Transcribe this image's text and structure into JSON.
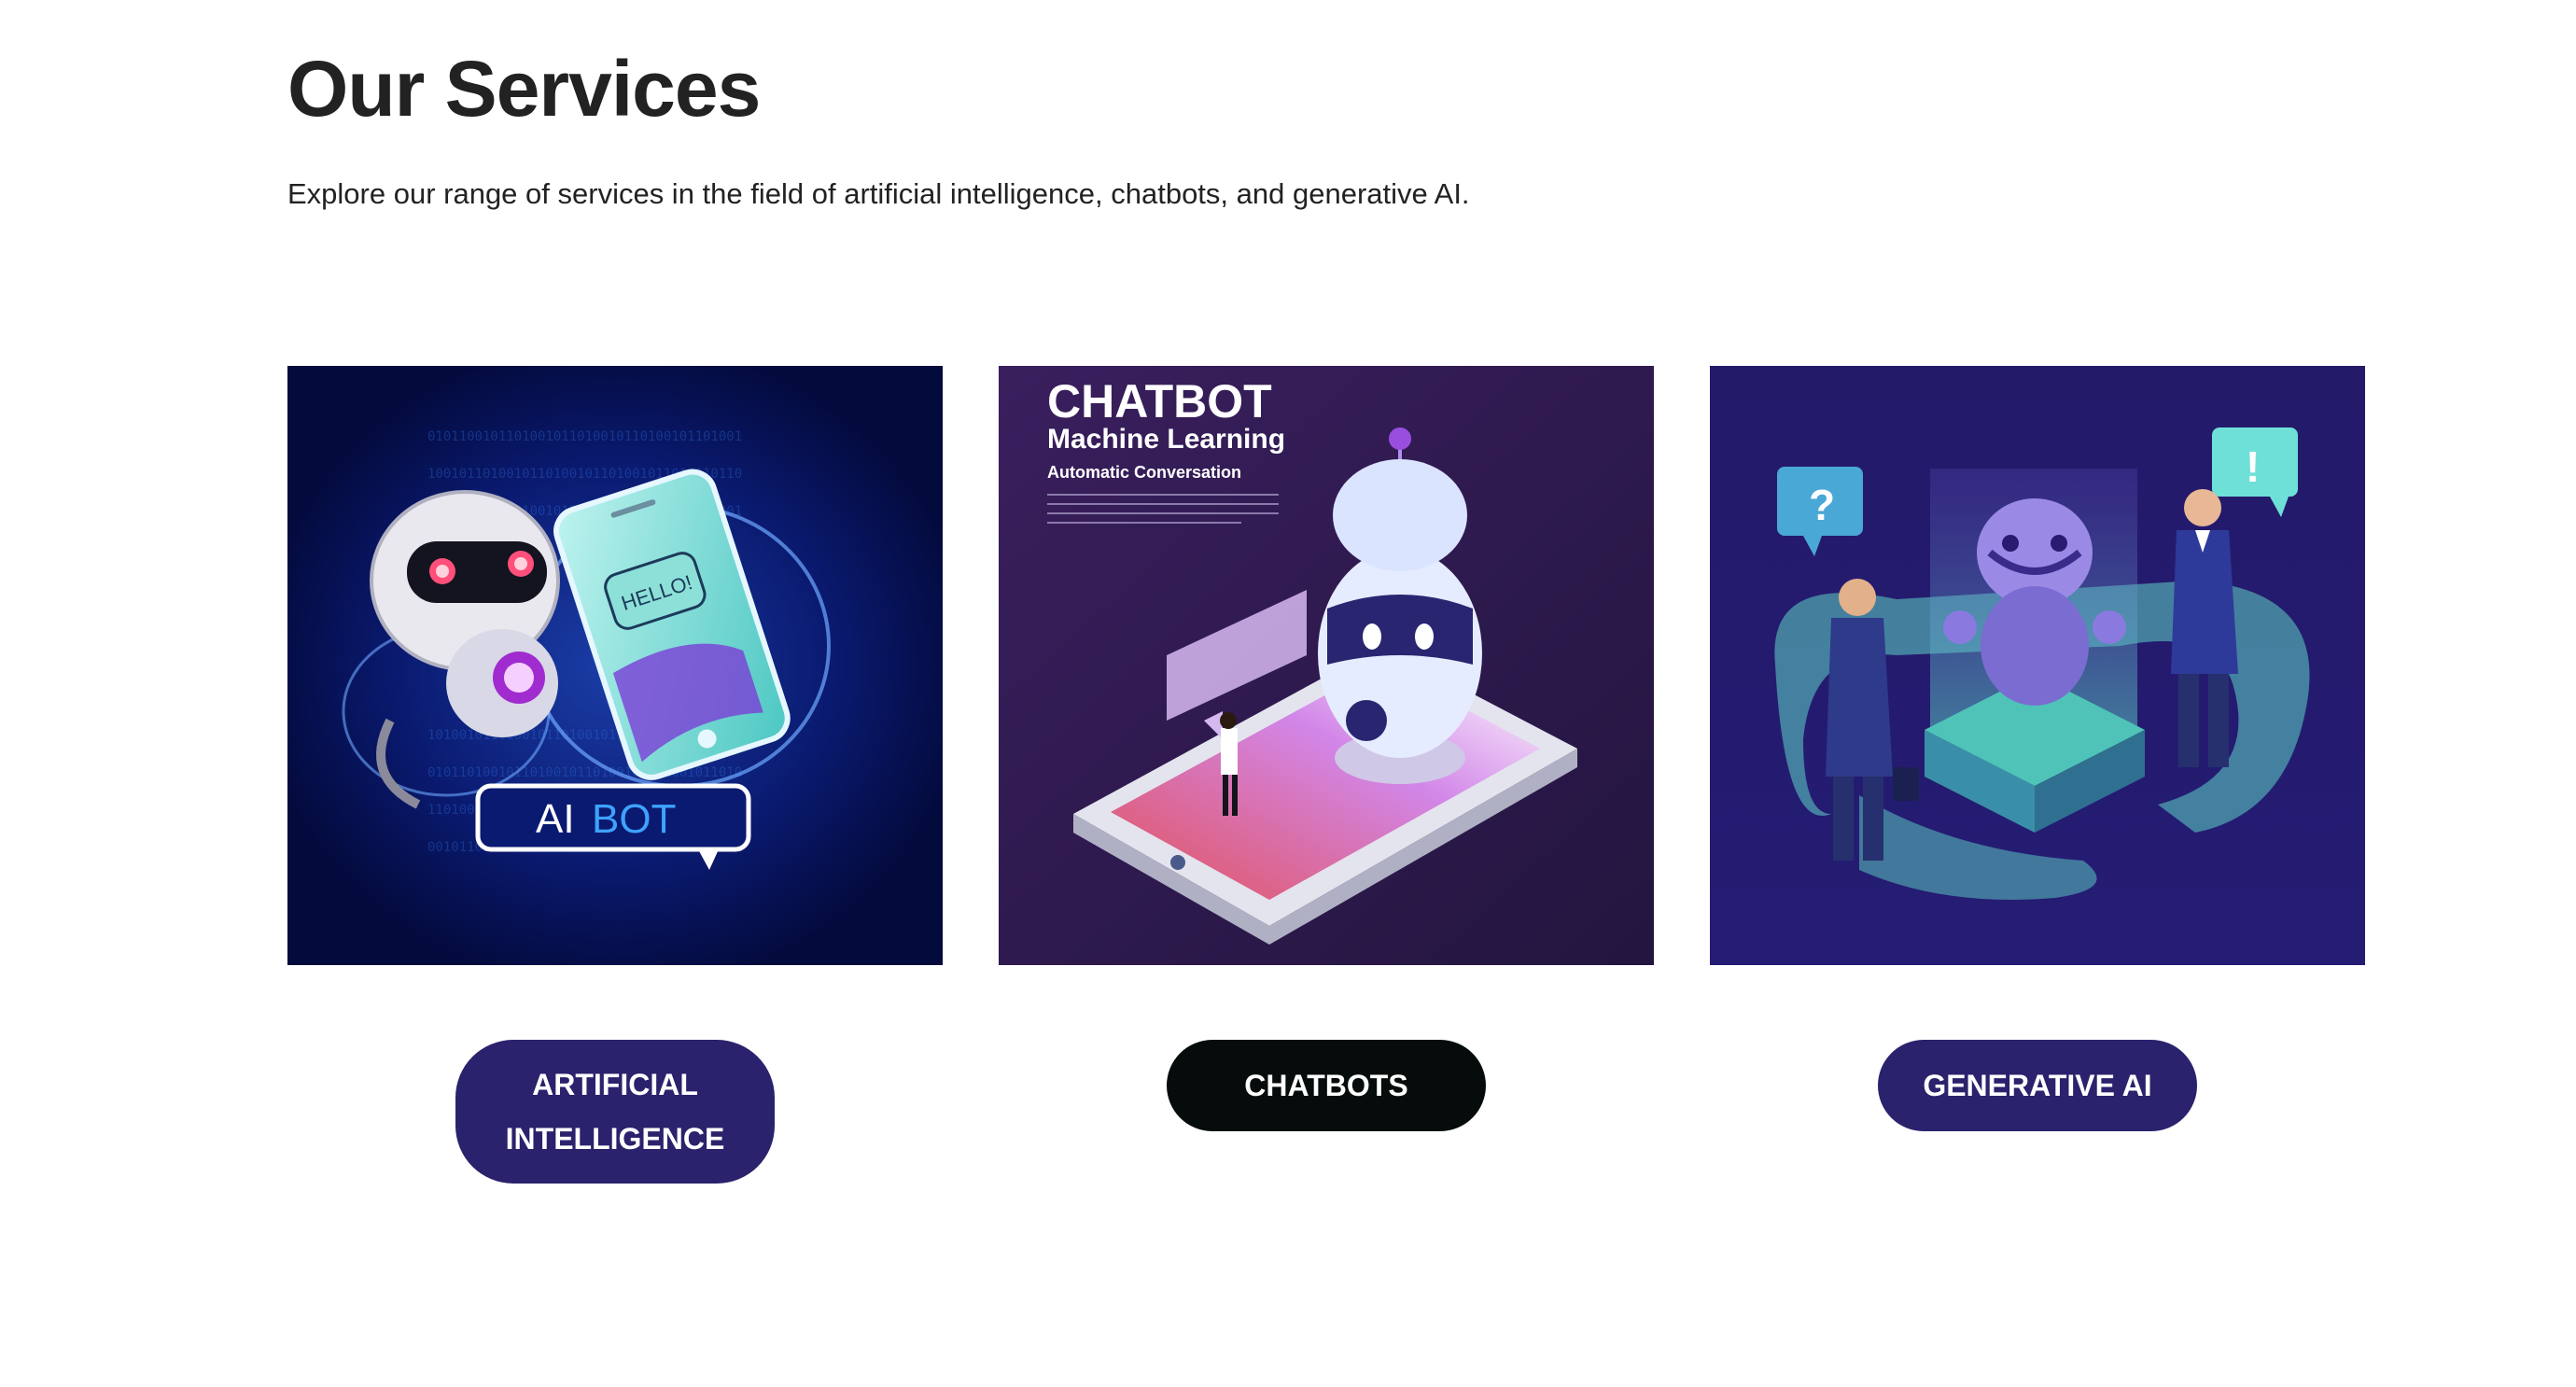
{
  "header": {
    "title": "Our Services",
    "subtitle": "Explore our range of services in the field of artificial intelligence, chatbots, and generative AI."
  },
  "cards": [
    {
      "image_text": {
        "ai": "AI",
        "bot": "BOT",
        "hello": "HELLO!"
      },
      "button_label": "ARTIFICIAL INTELLIGENCE",
      "button_color": "#2a226c"
    },
    {
      "image_text": {
        "title": "CHATBOT",
        "subtitle": "Machine Learning",
        "tagline": "Automatic Conversation"
      },
      "button_label": "CHATBOTS",
      "button_color": "#060c0c"
    },
    {
      "image_text": {
        "question": "?",
        "exclaim": "!"
      },
      "button_label": "GENERATIVE AI",
      "button_color": "#2a226c"
    }
  ],
  "colors": {
    "card1_bg": "#030a3c",
    "card2_bg": "#2e1a4e",
    "card3_bg": "#241a6e",
    "accent_teal": "#5fd3c6",
    "accent_purple": "#8c5cf0"
  }
}
